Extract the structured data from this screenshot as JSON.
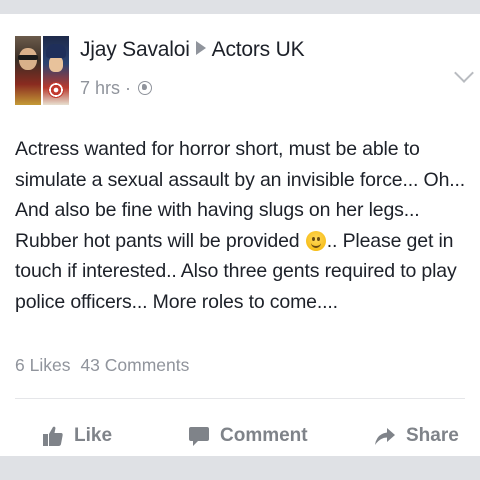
{
  "post": {
    "author": "Jjay Savaloi",
    "group": "Actors UK",
    "time": "7 hrs",
    "separator": "·",
    "privacy_icon": "globe-icon",
    "lines": [
      "Actress wanted for horror short, must be able to",
      "simulate a sexual assault by an invisible force... Oh...",
      "And also be fine with having slugs on her legs...",
      "Rubber hot pants will be provided",
      ".. Please get in",
      "touch if interested.. Also three gents required to play",
      "police officers... More roles to come...."
    ],
    "emoji": "smiling-face-emoji",
    "likes": "6 Likes",
    "comments": "43 Comments"
  },
  "actions": {
    "like": "Like",
    "comment": "Comment",
    "share": "Share"
  },
  "colors": {
    "background": "#dddfe2",
    "card": "#ffffff",
    "text": "#1d2129",
    "muted": "#90949c",
    "action": "#7f8389"
  }
}
